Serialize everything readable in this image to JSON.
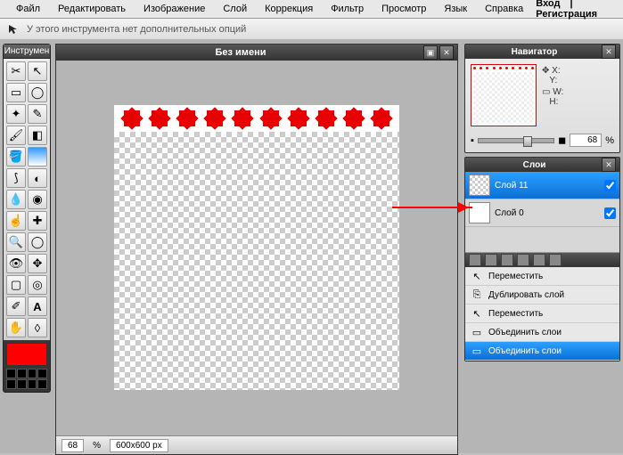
{
  "menu": {
    "file": "Файл",
    "edit": "Редактировать",
    "image": "Изображение",
    "layer": "Слой",
    "adjust": "Коррекция",
    "filter": "Фильтр",
    "view": "Просмотр",
    "lang": "Язык",
    "help": "Справка"
  },
  "auth": {
    "login": "Вход",
    "sep": "|",
    "register": "Регистрация"
  },
  "options": {
    "text": "У этого инструмента нет дополнительных опций"
  },
  "toolbox": {
    "title": "Инструмен"
  },
  "doc": {
    "title": "Без имени",
    "zoom": "68",
    "zoom_unit": "%",
    "dims": "600x600 px"
  },
  "navigator": {
    "title": "Навигатор",
    "x": "X:",
    "y": "Y:",
    "w": "W:",
    "h": "H:",
    "zoom": "68",
    "unit": "%"
  },
  "layers": {
    "title": "Слои",
    "items": [
      {
        "name": "Слой 11",
        "selected": true,
        "visible": true
      },
      {
        "name": "Слой 0",
        "selected": false,
        "visible": true
      }
    ]
  },
  "context": {
    "items": [
      {
        "icon": "↖",
        "label": "Переместить",
        "sel": false
      },
      {
        "icon": "⎘",
        "label": "Дублировать слой",
        "sel": false
      },
      {
        "icon": "↖",
        "label": "Переместить",
        "sel": false
      },
      {
        "icon": "▭",
        "label": "Объединить слои",
        "sel": false
      },
      {
        "icon": "▭",
        "label": "Объединить слои",
        "sel": true
      }
    ]
  },
  "colors": {
    "foreground": "#ff0000"
  }
}
